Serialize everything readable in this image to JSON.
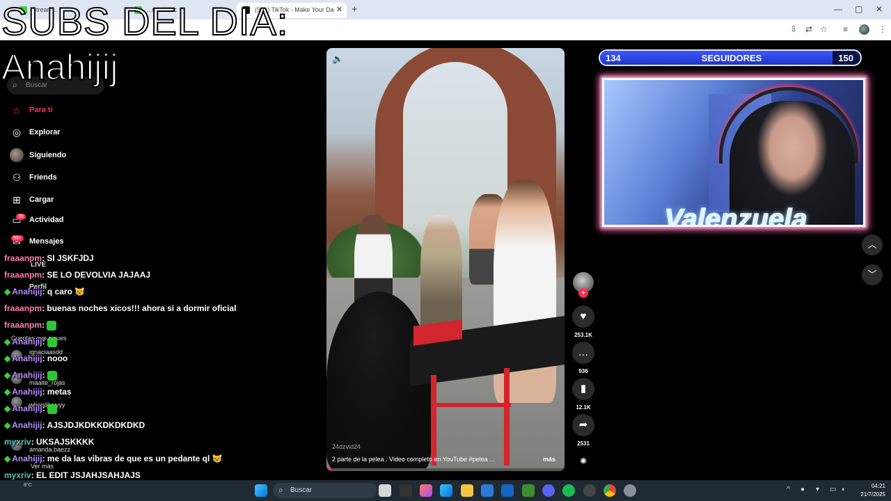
{
  "browser": {
    "tabs": [
      {
        "label": "Stream...",
        "active": false
      },
      {
        "label": "...m - Watc",
        "active": false
      },
      {
        "label": "(99+) TikTok - Make Your Da",
        "active": true
      }
    ],
    "new_tab_label": "+",
    "window_controls": [
      "—",
      "▢",
      "✕"
    ]
  },
  "overlay": {
    "title": "SUBS DEL DIA:",
    "name": "Anahijij"
  },
  "sidebar": {
    "search_placeholder": "Buscar",
    "items": [
      {
        "label": "Para ti",
        "icon": "home-icon",
        "glyph": "⌂",
        "active": true
      },
      {
        "label": "Explorar",
        "icon": "compass-icon",
        "glyph": "◎",
        "active": false
      },
      {
        "label": "Siguiendo",
        "icon": "following-avatar",
        "glyph": "",
        "active": false
      },
      {
        "label": "Friends",
        "icon": "friends-icon",
        "glyph": "⚇",
        "active": false
      },
      {
        "label": "Cargar",
        "icon": "upload-icon",
        "glyph": "⊞",
        "active": false
      },
      {
        "label": "Actividad",
        "icon": "activity-icon",
        "glyph": "▭",
        "active": false
      },
      {
        "label": "Mensajes",
        "icon": "messages-icon",
        "glyph": "✉",
        "active": false
      }
    ],
    "activity_badge": "35",
    "messages_badge": "99+",
    "faded": {
      "live": "LIVE",
      "profile": "Perfil",
      "following_accounts": "Cuentas que sigues",
      "accounts": [
        "ignaciaasdd",
        "maaite_rojas",
        "whoislilyyyyy",
        "amanda.baezz"
      ],
      "see_more": "Ver más"
    }
  },
  "chat": [
    {
      "user": "fraaanpm",
      "color": "pink",
      "badge": false,
      "message": ": SI JSKFJDJ"
    },
    {
      "user": "fraaanpm",
      "color": "pink",
      "badge": false,
      "message": ": SE LO DEVOLVIA JAJAAJ"
    },
    {
      "user": "Anahijij",
      "color": "purple",
      "badge": true,
      "message": ": q caro 😿"
    },
    {
      "user": "fraaanpm",
      "color": "pink",
      "badge": false,
      "message": ": buenas noches xicos!!! ahora si a dormir oficial"
    },
    {
      "user": "fraaanpm",
      "color": "pink",
      "badge": false,
      "message": ":",
      "emote": true
    },
    {
      "user": "Anahijij",
      "color": "purple",
      "badge": true,
      "message": ":",
      "emote": true
    },
    {
      "user": "Anahijij",
      "color": "purple",
      "badge": true,
      "message": ": nooo"
    },
    {
      "user": "Anahijij",
      "color": "purple",
      "badge": true,
      "message": ":",
      "emote": true
    },
    {
      "user": "Anahijij",
      "color": "purple",
      "badge": true,
      "message": ": metas"
    },
    {
      "user": "Anahijij",
      "color": "purple",
      "badge": true,
      "message": ":",
      "emote": true
    },
    {
      "user": "Anahijij",
      "color": "purple",
      "badge": true,
      "message": ": AJSJDJKDKKDKDKDKD"
    },
    {
      "user": "myxriv",
      "color": "teal",
      "badge": false,
      "message": ": UKSAJSKKKK"
    },
    {
      "user": "Anahijij",
      "color": "purple",
      "badge": true,
      "message": ": me da las vibras de que es un pedante ql 😿"
    },
    {
      "user": "myxriv",
      "color": "teal",
      "badge": false,
      "message": ": EL EDIT JSJAHJSAHJAJS"
    },
    {
      "user": "Anahijij",
      "color": "purple",
      "badge": true,
      "message": ": 😊😢"
    }
  ],
  "video": {
    "username": "24dzvid24",
    "caption": "2 parte de la pelea . Video completo en YouTube #pelea ...",
    "more_label": "más",
    "progress": 0.02
  },
  "actions": {
    "likes": "253.1K",
    "comments": "936",
    "saves": "12.1K",
    "shares": "2531"
  },
  "goal": {
    "start": "134",
    "label": "SEGUIDORES",
    "end": "150",
    "progress": 0.893
  },
  "webcam": {
    "name": "Valenzuela"
  },
  "taskbar": {
    "search_placeholder": "Buscar",
    "weather": "8°C",
    "time": "04:21",
    "date": "21/7/2025"
  },
  "colors": {
    "tiktok_accent": "#fe2c55",
    "goal_blue": "#2d45e0",
    "webcam_glow": "#ff6fb0"
  }
}
